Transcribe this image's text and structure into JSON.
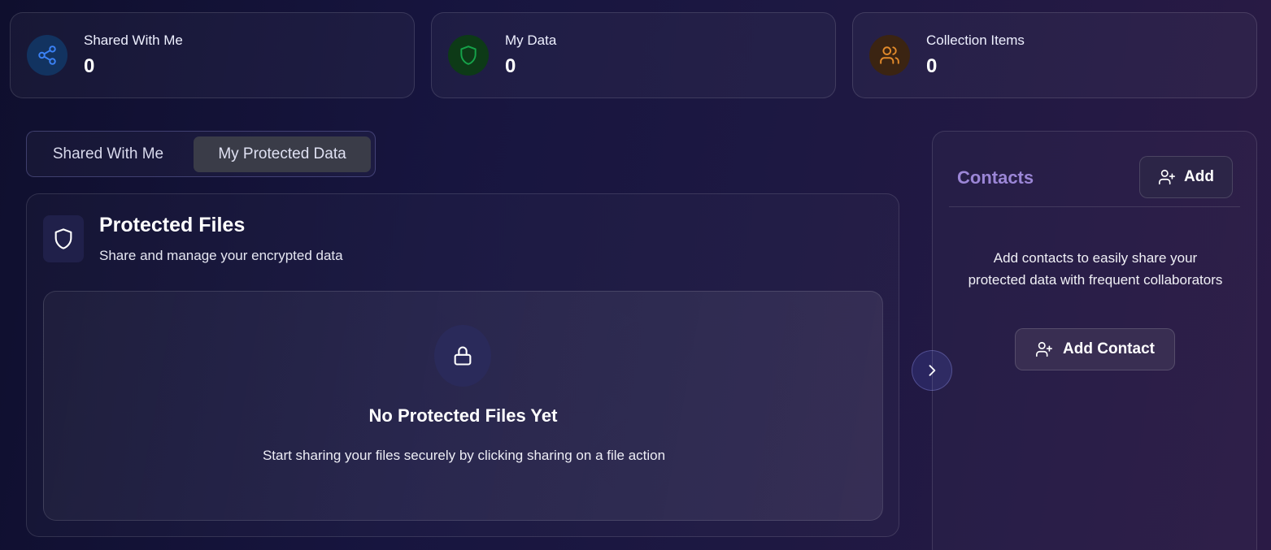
{
  "stats": [
    {
      "label": "Shared With Me",
      "value": "0",
      "icon": "share-icon",
      "color": "#3b82f6",
      "bg": "#123360"
    },
    {
      "label": "My Data",
      "value": "0",
      "icon": "shield-icon",
      "color": "#16a34a",
      "bg": "#0d3a17"
    },
    {
      "label": "Collection Items",
      "value": "0",
      "icon": "users-icon",
      "color": "#e28a2b",
      "bg": "#3b2412"
    }
  ],
  "tabs": [
    {
      "label": "Shared With Me",
      "active": false
    },
    {
      "label": "My Protected Data",
      "active": true
    }
  ],
  "panel": {
    "title": "Protected Files",
    "subtitle": "Share and manage your encrypted data",
    "empty_title": "No Protected Files Yet",
    "empty_text": "Start sharing your files securely by clicking sharing on a file action"
  },
  "contacts": {
    "title": "Contacts",
    "add_label": "Add",
    "empty_text": "Add contacts to easily share your protected data with frequent collaborators",
    "add_contact_label": "Add Contact"
  }
}
